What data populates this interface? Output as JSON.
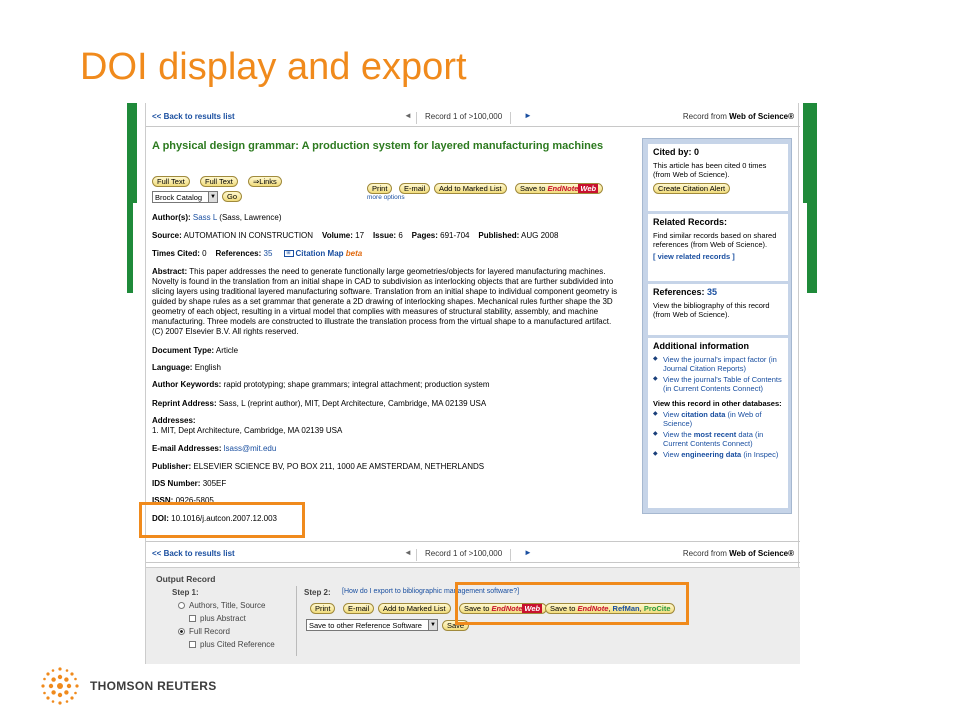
{
  "slide": {
    "title": "DOI display and export",
    "brand": "THOMSON REUTERS"
  },
  "nav": {
    "back": "<< Back to results list",
    "prev": "◄",
    "record": "Record 1   of   >100,000",
    "next": "►",
    "source_prefix": "Record from ",
    "source": "Web of Science®"
  },
  "article": {
    "title": "A physical design grammar: A production system for layered manufacturing machines",
    "buttons": {
      "full_text_1": "Full Text",
      "full_text_2": "Full Text",
      "links": "⇒Links",
      "print": "Print",
      "email": "E-mail",
      "add_marked": "Add to Marked List",
      "save_endnote_prefix": "Save to ",
      "endnote": "EndNote",
      "web": "Web",
      "more_options": "more options",
      "go": "Go"
    },
    "catalog_select": "Brock Catalog",
    "authors_label": "Author(s):",
    "authors_link": "Sass L",
    "authors_rest": " (Sass, Lawrence)",
    "source_label": "Source:",
    "source": "AUTOMATION IN CONSTRUCTION",
    "volume_label": "Volume:",
    "volume": "17",
    "issue_label": "Issue:",
    "issue": "6",
    "pages_label": "Pages:",
    "pages": "691-704",
    "published_label": "Published:",
    "published": "AUG 2008",
    "times_cited_label": "Times Cited:",
    "times_cited": "0",
    "references_label": "References:",
    "references": "35",
    "citation_map": "Citation Map",
    "beta": "beta",
    "abstract_label": "Abstract:",
    "abstract": "This paper addresses the need to generate functionally large geometries/objects for layered manufacturing machines. Novelty is found in the translation from an initial shape in CAD to subdivision as interlocking objects that are further subdivided into slicing layers using traditional layered manufacturing software. Translation from an initial shape to individual component geometry is guided by shape rules as a set grammar that generate a 2D drawing of interlocking shapes. Mechanical rules further shape the 3D geometry of each object, resulting in a virtual model that complies with measures of structural stability, assembly, and machine manufacturing. Three models are constructed to illustrate the translation process from the virtual shape to a manufactured artifact. (C) 2007 Elsevier B.V. All rights reserved.",
    "doctype_label": "Document Type:",
    "doctype": "Article",
    "language_label": "Language:",
    "language": "English",
    "keywords_label": "Author Keywords:",
    "keywords": "rapid prototyping; shape grammars; integral attachment; production system",
    "reprint_label": "Reprint Address:",
    "reprint": "Sass, L (reprint author), MIT, Dept Architecture, Cambridge, MA 02139 USA",
    "addresses_label": "Addresses:",
    "addresses": "1. MIT, Dept Architecture, Cambridge, MA 02139 USA",
    "email_label": "E-mail Addresses:",
    "email": "lsass@mit.edu",
    "publisher_label": "Publisher:",
    "publisher": "ELSEVIER SCIENCE BV, PO BOX 211, 1000 AE AMSTERDAM, NETHERLANDS",
    "ids_label": "IDS Number:",
    "ids": "305EF",
    "issn_label": "ISSN:",
    "issn": "0926-5805",
    "doi_label": "DOI:",
    "doi": "10.1016/j.autcon.2007.12.003"
  },
  "sidebar": {
    "cited_by_label": "Cited by:",
    "cited_by": "0",
    "cited_by_text": "This article has been cited 0 times (from Web of Science).",
    "create_alert": "Create Citation Alert",
    "related_label": "Related Records:",
    "related_text": "Find similar records based on shared references (from Web of Science).",
    "related_link": "[ view related records ]",
    "references_label": "References:",
    "references": "35",
    "references_text": "View the bibliography of this record (from Web of Science).",
    "additional_label": "Additional information",
    "impact": "View the journal's impact factor (in Journal Citation Reports)",
    "toc": "View the journal's Table of Contents (in Current Contents Connect)",
    "other_db_label": "View this record in other databases:",
    "citation_data_pre": "View ",
    "citation_data": "citation data",
    "citation_data_post": " (in Web of Science)",
    "most_recent_pre": "View the ",
    "most_recent": "most recent",
    "most_recent_post": " data (in Current Contents Connect)",
    "engineering_pre": "View ",
    "engineering": "engineering data",
    "engineering_post": " (in Inspec)"
  },
  "output": {
    "title": "Output Record",
    "step1": "Step 1:",
    "opt_authors": "Authors, Title, Source",
    "opt_abstract": "plus Abstract",
    "opt_full": "Full Record",
    "opt_cited": "plus Cited Reference",
    "step2": "Step 2:",
    "help": "[How do I export to bibliographic management software?]",
    "print": "Print",
    "email": "E-mail",
    "add_marked": "Add to Marked List",
    "save_prefix": "Save to ",
    "endnote": "EndNote",
    "web": "Web",
    "save_prefix2": "Save to ",
    "endnote2": "EndNote",
    "refman": "RefMan",
    "procite": "ProCite",
    "other_select": "Save to other Reference Software",
    "save": "Save"
  },
  "colors": {
    "title_orange": "#f08a1c",
    "article_green": "#2c7a1f",
    "link_blue": "#1a4fa0",
    "sidebar_blue": "#c6d4e8",
    "highlight_orange": "#f08a1c"
  }
}
